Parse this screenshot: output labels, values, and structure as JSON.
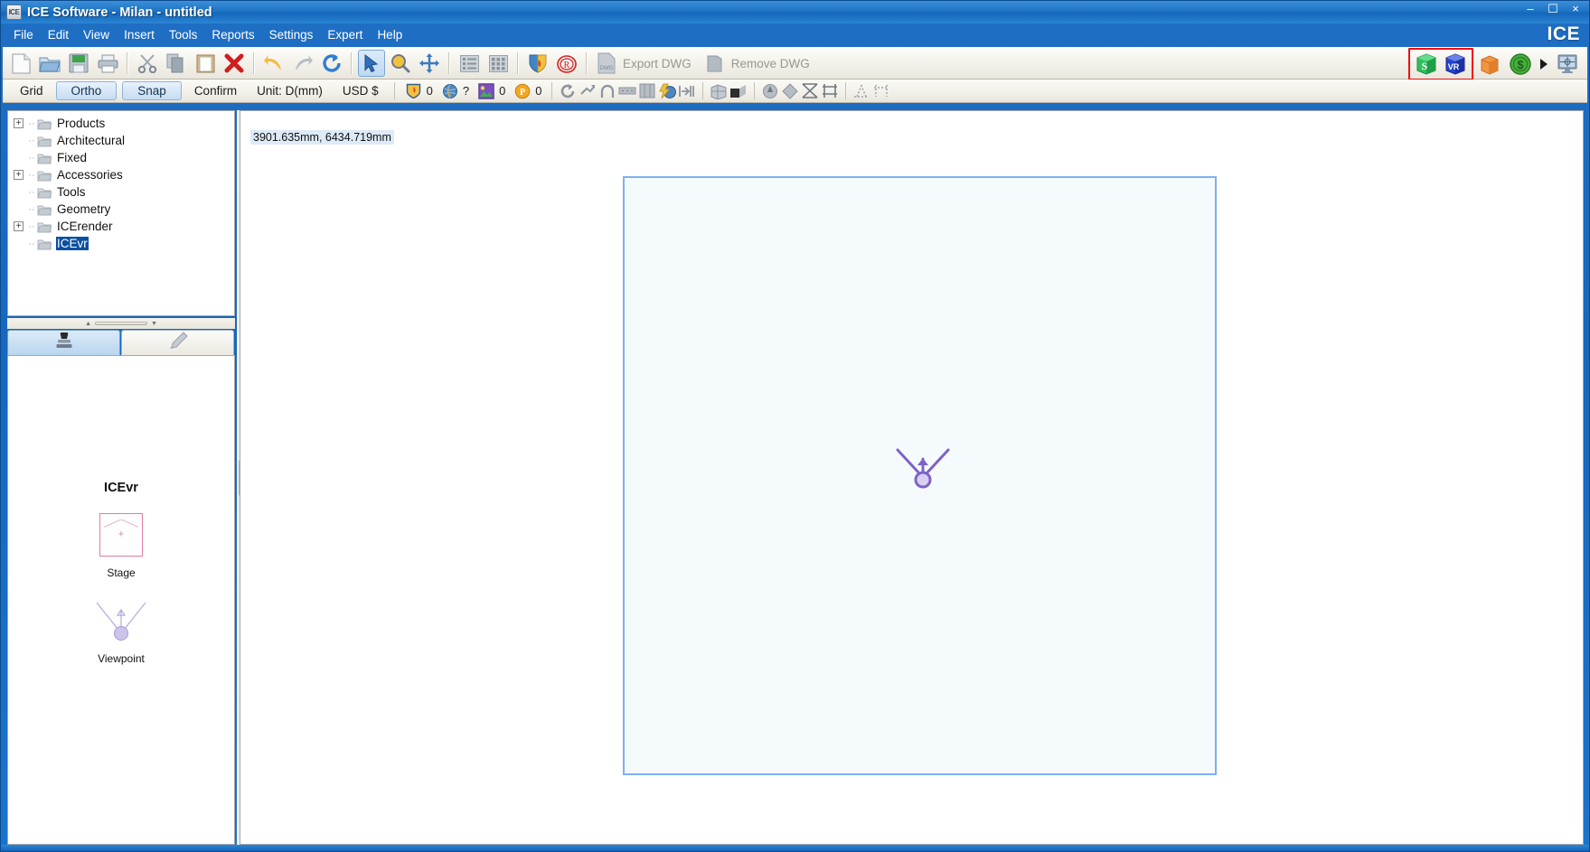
{
  "window": {
    "title": "ICE Software - Milan - untitled",
    "app_icon_label": "ICE",
    "brand": "ICE",
    "minimize": "–",
    "maximize": "☐",
    "close": "×"
  },
  "menu": {
    "items": [
      {
        "label": "File"
      },
      {
        "label": "Edit"
      },
      {
        "label": "View"
      },
      {
        "label": "Insert"
      },
      {
        "label": "Tools"
      },
      {
        "label": "Reports"
      },
      {
        "label": "Settings"
      },
      {
        "label": "Expert"
      },
      {
        "label": "Help"
      }
    ]
  },
  "toolbar_main": {
    "buttons": [
      {
        "name": "new-document-icon",
        "label": "New"
      },
      {
        "name": "open-folder-icon",
        "label": "Open"
      },
      {
        "name": "save-icon",
        "label": "Save"
      },
      {
        "name": "print-icon",
        "label": "Print"
      },
      {
        "name": "cut-scissors-icon",
        "label": "Cut"
      },
      {
        "name": "copy-icon",
        "label": "Copy"
      },
      {
        "name": "paste-icon",
        "label": "Paste"
      },
      {
        "name": "delete-x-icon",
        "label": "Delete"
      },
      {
        "name": "undo-arrow-icon",
        "label": "Undo"
      },
      {
        "name": "redo-arrow-icon",
        "label": "Redo"
      },
      {
        "name": "refresh-icon",
        "label": "Refresh"
      },
      {
        "name": "select-pointer-icon",
        "label": "Select"
      },
      {
        "name": "zoom-magnifier-icon",
        "label": "Zoom"
      },
      {
        "name": "pan-move-icon",
        "label": "Pan"
      },
      {
        "name": "list-view-icon",
        "label": "List View"
      },
      {
        "name": "grid-view-icon",
        "label": "Grid View"
      },
      {
        "name": "shield-flame-icon",
        "label": "Fire Safety"
      },
      {
        "name": "stamp-red-icon",
        "label": "Stamp"
      }
    ],
    "export_dwg_label": "Export DWG",
    "remove_dwg_label": "Remove DWG",
    "right_icons": [
      {
        "name": "sketchup-cube-icon",
        "label": "S",
        "color": "#22a84b",
        "highlighted": true
      },
      {
        "name": "vr-cube-icon",
        "label": "VR",
        "color": "#1e46c8",
        "highlighted": true
      },
      {
        "name": "orange-box-icon",
        "label": "",
        "color": "#f08a3c",
        "highlighted": false
      },
      {
        "name": "dollar-circle-icon",
        "label": "$",
        "color": "#3fae36",
        "highlighted": false
      },
      {
        "name": "play-arrow-icon",
        "label": "▶",
        "color": "#111111",
        "highlighted": false
      },
      {
        "name": "monitor-target-icon",
        "label": "",
        "color": "#5a7fa5",
        "highlighted": false
      }
    ]
  },
  "toolbar_options": {
    "grid_label": "Grid",
    "ortho_label": "Ortho",
    "snap_label": "Snap",
    "confirm_label": "Confirm",
    "unit_label": "Unit: D(mm)",
    "currency_label": "USD $",
    "counters": [
      {
        "name": "shield-count",
        "value": "0"
      },
      {
        "name": "globe-count",
        "value": "?"
      },
      {
        "name": "image-count",
        "value": "0"
      },
      {
        "name": "power-count",
        "value": "0"
      }
    ],
    "tool_icons": [
      {
        "name": "rotate-icon"
      },
      {
        "name": "mirror-icon"
      },
      {
        "name": "arc-icon"
      },
      {
        "name": "dashed-line-icon"
      },
      {
        "name": "panel-icon"
      },
      {
        "name": "lightning-globe-icon"
      },
      {
        "name": "align-icon"
      },
      {
        "name": "cube-grid-icon"
      },
      {
        "name": "cube-solid-icon"
      },
      {
        "name": "circle-marker-icon"
      },
      {
        "name": "diamond-icon"
      },
      {
        "name": "truss-x-icon"
      },
      {
        "name": "truss-bridge-icon"
      },
      {
        "name": "measure-left-icon"
      },
      {
        "name": "measure-right-icon"
      }
    ]
  },
  "tree": {
    "items": [
      {
        "label": "Products",
        "expandable": true,
        "selected": false
      },
      {
        "label": "Architectural",
        "expandable": false,
        "selected": false
      },
      {
        "label": "Fixed",
        "expandable": false,
        "selected": false
      },
      {
        "label": "Accessories",
        "expandable": true,
        "selected": false
      },
      {
        "label": "Tools",
        "expandable": false,
        "selected": false
      },
      {
        "label": "Geometry",
        "expandable": false,
        "selected": false
      },
      {
        "label": "ICErender",
        "expandable": true,
        "selected": false
      },
      {
        "label": "ICEvr",
        "expandable": false,
        "selected": true
      }
    ],
    "expander_plus": "+"
  },
  "panel_tabs": [
    {
      "name": "tab-stamp",
      "icon": "stamp-icon",
      "active": true
    },
    {
      "name": "tab-pencil",
      "icon": "pencil-icon",
      "active": false
    }
  ],
  "properties_panel": {
    "title": "ICEvr",
    "items": [
      {
        "name": "stage-item",
        "caption": "Stage",
        "color": "#e07ba8"
      },
      {
        "name": "viewpoint-item",
        "caption": "Viewpoint",
        "color": "#a89ad8"
      }
    ]
  },
  "canvas": {
    "coordinate_readout": "3901.635mm, 6434.719mm",
    "stage": {
      "border_color": "#7eb0ef",
      "fill_color": "#f5fafd"
    },
    "viewpoint_marker": {
      "color": "#7e63c4"
    }
  }
}
